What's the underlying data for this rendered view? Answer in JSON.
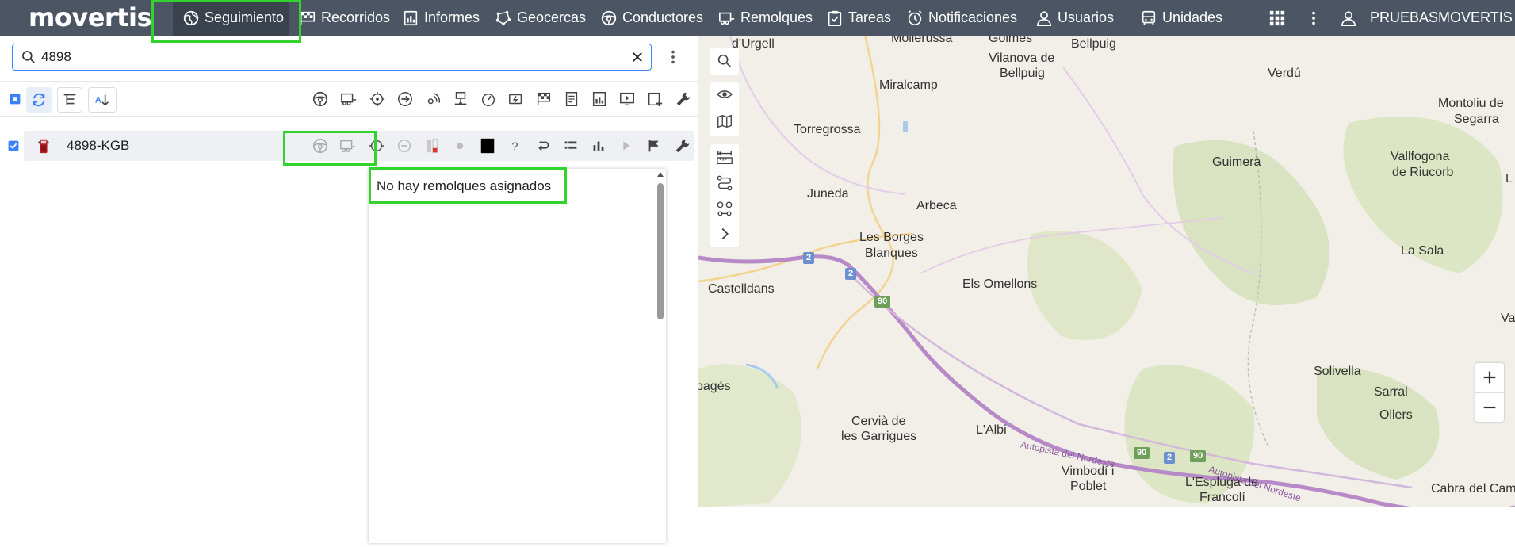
{
  "brand": {
    "logo_text": "movertis"
  },
  "nav": [
    {
      "key": "seguimiento",
      "label": "Seguimiento",
      "icon": "globe-icon",
      "active": true
    },
    {
      "key": "recorridos",
      "label": "Recorridos",
      "icon": "checkered-flag-icon"
    },
    {
      "key": "informes",
      "label": "Informes",
      "icon": "report-icon"
    },
    {
      "key": "geocercas",
      "label": "Geocercas",
      "icon": "polygon-icon"
    },
    {
      "key": "conductores",
      "label": "Conductores",
      "icon": "steering-wheel-icon"
    },
    {
      "key": "remolques",
      "label": "Remolques",
      "icon": "trailer-icon"
    },
    {
      "key": "tareas",
      "label": "Tareas",
      "icon": "clipboard-check-icon"
    },
    {
      "key": "notificaciones",
      "label": "Notificaciones",
      "icon": "alarm-icon"
    },
    {
      "key": "usuarios",
      "label": "Usuarios",
      "icon": "user-icon"
    },
    {
      "key": "unidades",
      "label": "Unidades",
      "icon": "bus-icon"
    }
  ],
  "user": {
    "name": "PRUEBASMOVERTIS"
  },
  "search": {
    "value": "4898"
  },
  "unit_row": {
    "name": "4898-KGB",
    "checked": true
  },
  "dropdown": {
    "message": "No hay remolques asignados"
  },
  "map": {
    "labels": [
      "d'Urgell",
      "Mollerussa",
      "Golmés",
      "Bellpuig",
      "Vilanova de",
      "Bellpuig",
      "Verdú",
      "Montoliu de",
      "Segarra",
      "Miralcamp",
      "Torregrossa",
      "Guimerà",
      "Vallfogona",
      "de Riucorb",
      "Juneda",
      "Arbeca",
      "Les Borges",
      "Blanques",
      "La Sala",
      "Castelldans",
      "Els Omellons",
      "Solivella",
      "Sarral",
      "Cervià de",
      "les Garrigues",
      "L'Albi",
      "Vimbodí i",
      "Poblet",
      "L'Espluga de",
      "Francolí",
      "Ollers",
      "Cabra del Cam",
      "Autopista del Nordeste",
      "Autopista del Nordeste",
      "bagés",
      "Va",
      "L"
    ],
    "road_shields": [
      "2",
      "2",
      "90",
      "90",
      "2",
      "90"
    ]
  },
  "colors": {
    "topbar": "#4b5563",
    "highlight": "#31d32c",
    "accent": "#3b82f6"
  }
}
